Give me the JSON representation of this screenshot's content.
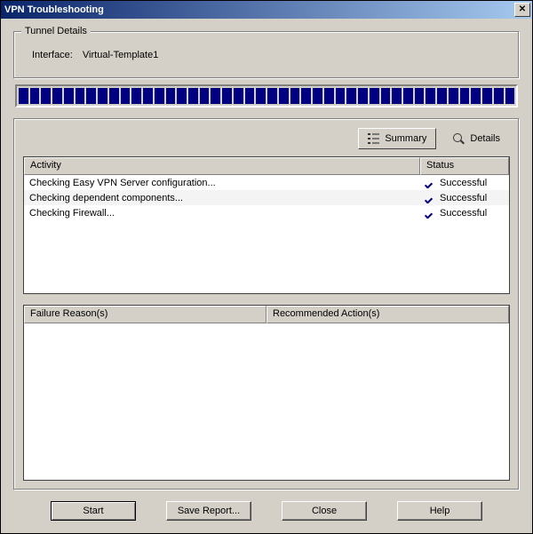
{
  "title": "VPN Troubleshooting",
  "tunnel": {
    "legend": "Tunnel Details",
    "interface_label": "Interface:",
    "interface_value": "Virtual-Template1"
  },
  "toolbar": {
    "summary_label": "Summary",
    "details_label": "Details"
  },
  "grid": {
    "col_activity": "Activity",
    "col_status": "Status",
    "rows": [
      {
        "activity": "Checking Easy VPN Server configuration...",
        "status": "Successful"
      },
      {
        "activity": "Checking dependent components...",
        "status": "Successful"
      },
      {
        "activity": "Checking Firewall...",
        "status": "Successful"
      }
    ]
  },
  "split": {
    "failure_label": "Failure Reason(s)",
    "recommended_label": "Recommended Action(s)"
  },
  "buttons": {
    "start": "Start",
    "save_report": "Save Report...",
    "close": "Close",
    "help": "Help"
  },
  "progress_segments": 44,
  "colors": {
    "progress_fill": "#000080",
    "titlebar_start": "#0a246a",
    "titlebar_end": "#a6caf0"
  }
}
